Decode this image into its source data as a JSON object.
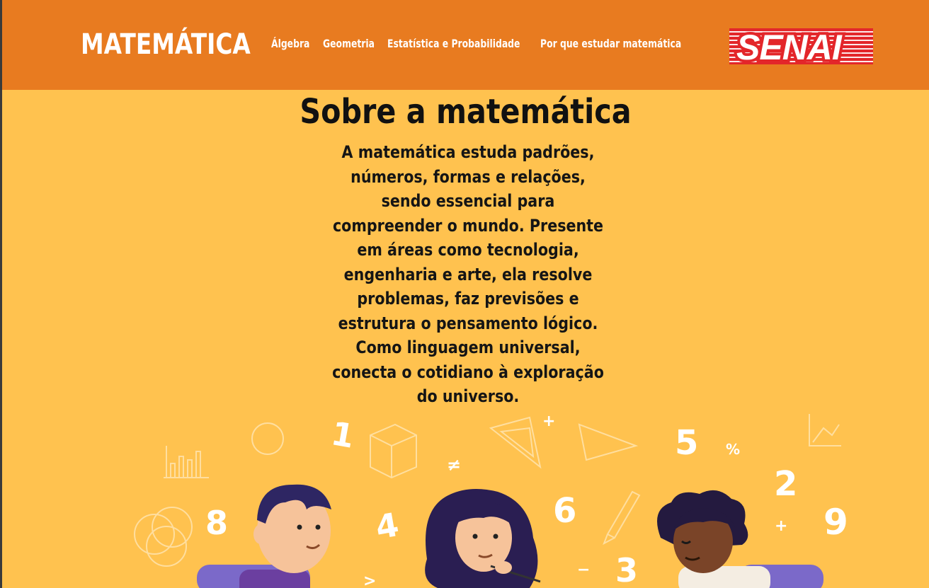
{
  "header": {
    "brand": "MATEMÁTICA",
    "nav": [
      "Álgebra",
      "Geometria",
      "Estatística e Probabilidade",
      "Por que estudar matemática"
    ],
    "logo_text": "SENAI"
  },
  "main": {
    "title": "Sobre a matemática",
    "about": "A matemática estuda padrões, números, formas e relações, sendo essencial para compreender o mundo. Presente em áreas como tecnologia, engenharia e arte, ela resolve problemas, faz previsões e estrutura o pensamento lógico. Como linguagem universal, conecta o cotidiano à exploração do universo."
  },
  "illustration": {
    "numbers": [
      "1",
      "5",
      "2",
      "8",
      "4",
      "6",
      "9",
      "3"
    ],
    "symbols": [
      "+",
      "≠",
      "%",
      "+",
      "−",
      ">"
    ]
  },
  "colors": {
    "header": "#e87b20",
    "background": "#ffc24f",
    "logo": "#e3262a"
  }
}
